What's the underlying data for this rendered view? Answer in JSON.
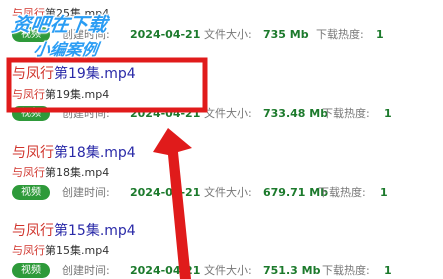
{
  "labels": {
    "badge": "视频",
    "created": "创建时间:",
    "size": "文件大小:",
    "heat": "下载热度:"
  },
  "items": [
    {
      "keyword": "与凤行",
      "title_rest": "第25集.mp4",
      "sub_rest": "第25集.mp4",
      "date": "2024-04-21",
      "size": "735 Mb",
      "heat": "1"
    },
    {
      "keyword": "与凤行",
      "title_rest": "第19集.mp4",
      "sub_rest": "第19集.mp4",
      "date": "2024-04-21",
      "size": "733.48 Mb",
      "heat": "1"
    },
    {
      "keyword": "与凤行",
      "title_rest": "第18集.mp4",
      "sub_rest": "第18集.mp4",
      "date": "2024-04-21",
      "size": "679.71 Mb",
      "heat": "1"
    },
    {
      "keyword": "与凤行",
      "title_rest": "第15集.mp4",
      "sub_rest": "第15集.mp4",
      "date": "2024-04-21",
      "size": "751.3 Mb",
      "heat": "1"
    }
  ],
  "watermark": {
    "line1": "资吧在下载",
    "line2": "小编案例"
  },
  "colors": {
    "highlight_box": "#e01b1b",
    "arrow": "#e01b1b",
    "badge": "#2e9a3a",
    "value_green": "#1c7a2c"
  }
}
